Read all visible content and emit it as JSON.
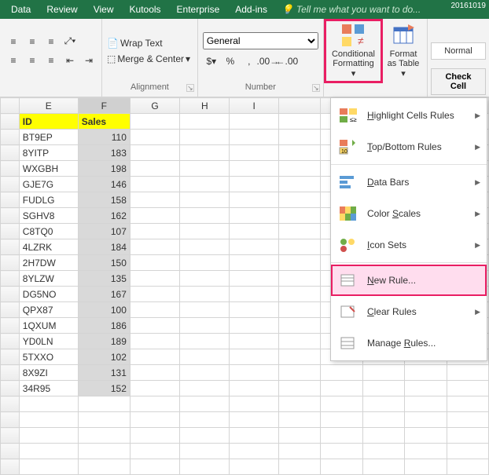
{
  "tabs": {
    "data": "Data",
    "review": "Review",
    "view": "View",
    "kutools": "Kutools",
    "enterprise": "Enterprise",
    "addins": "Add-ins"
  },
  "tell": "Tell me what you want to do...",
  "topdate": "20161019",
  "alignment": {
    "wrap": "Wrap Text",
    "merge": "Merge & Center",
    "label": "Alignment"
  },
  "number": {
    "format": "General",
    "label": "Number"
  },
  "cf": {
    "button": "Conditional Formatting",
    "fat": "Format as Table"
  },
  "styles": {
    "normal": "Normal",
    "check": "Check Cell"
  },
  "menu": {
    "hcr": "Highlight Cells Rules",
    "tbr": "Top/Bottom Rules",
    "db": "Data Bars",
    "cs": "Color Scales",
    "is": "Icon Sets",
    "nr": "New Rule...",
    "cr": "Clear Rules",
    "mr": "Manage Rules..."
  },
  "cols": {
    "e": "E",
    "f": "F",
    "g": "G",
    "h": "H",
    "i": "I"
  },
  "headers": {
    "id": "ID",
    "sales": "Sales"
  },
  "rows": [
    {
      "id": "BT9EP",
      "sales": 110
    },
    {
      "id": "8YITP",
      "sales": 183
    },
    {
      "id": "WXGBH",
      "sales": 198
    },
    {
      "id": "GJE7G",
      "sales": 146
    },
    {
      "id": "FUDLG",
      "sales": 158
    },
    {
      "id": "SGHV8",
      "sales": 162
    },
    {
      "id": "C8TQ0",
      "sales": 107
    },
    {
      "id": "4LZRK",
      "sales": 184
    },
    {
      "id": "2H7DW",
      "sales": 150
    },
    {
      "id": "8YLZW",
      "sales": 135
    },
    {
      "id": "DG5NO",
      "sales": 167
    },
    {
      "id": "QPX87",
      "sales": 100
    },
    {
      "id": "1QXUM",
      "sales": 186
    },
    {
      "id": "YD0LN",
      "sales": 189
    },
    {
      "id": "5TXXO",
      "sales": 102
    },
    {
      "id": "8X9ZI",
      "sales": 131
    },
    {
      "id": "34R95",
      "sales": 152
    }
  ]
}
